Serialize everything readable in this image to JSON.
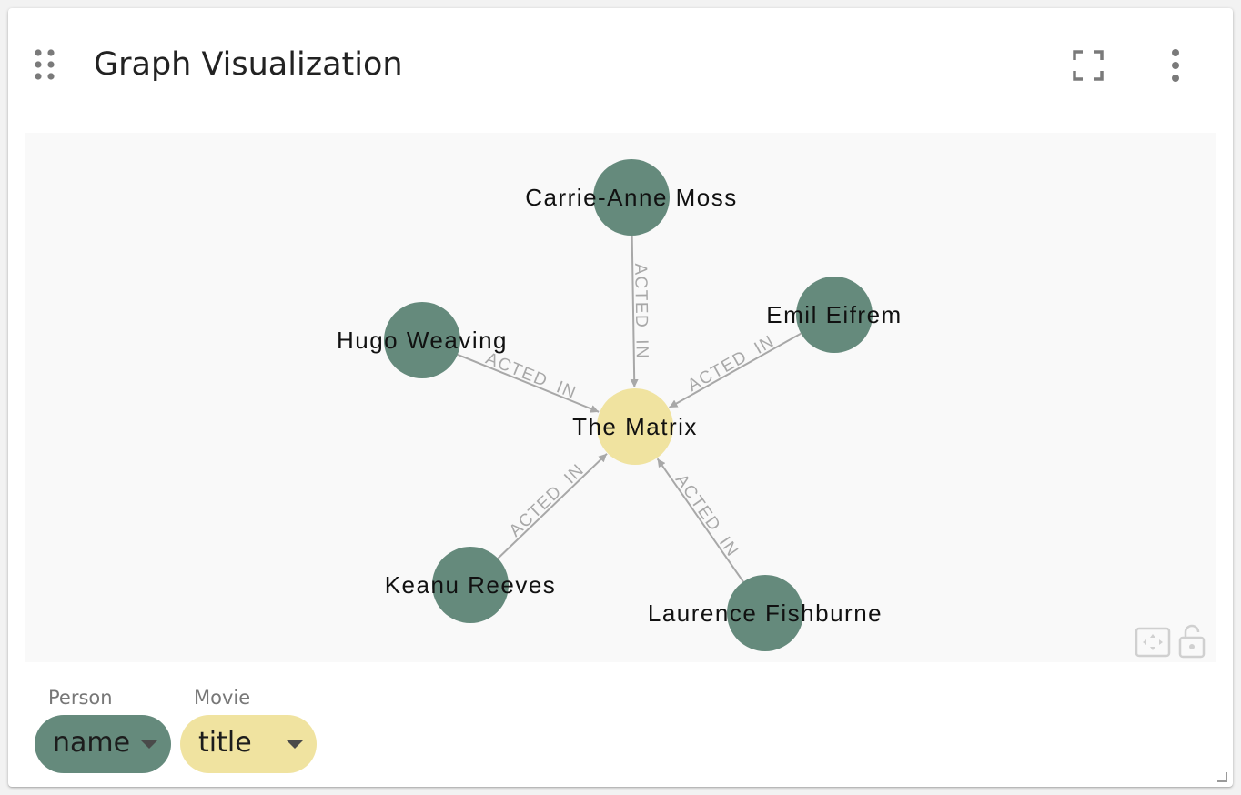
{
  "panel": {
    "title": "Graph Visualization"
  },
  "icons": {
    "drag": "drag-handle-icon",
    "fullscreen": "fullscreen-icon",
    "more": "more-vert-icon",
    "fit": "fit-to-screen-icon",
    "lock": "lock-open-icon"
  },
  "colors": {
    "person_node": "#658a7c",
    "movie_node": "#f0e3a0",
    "edge": "#a8a8a8",
    "graph_background": "#f9f9f9"
  },
  "graph": {
    "nodes": [
      {
        "id": "matrix",
        "label": "The Matrix",
        "type": "Movie"
      },
      {
        "id": "carrie",
        "label": "Carrie-Anne Moss",
        "type": "Person"
      },
      {
        "id": "hugo",
        "label": "Hugo Weaving",
        "type": "Person"
      },
      {
        "id": "emil",
        "label": "Emil Eifrem",
        "type": "Person"
      },
      {
        "id": "keanu",
        "label": "Keanu Reeves",
        "type": "Person"
      },
      {
        "id": "laurence",
        "label": "Laurence Fishburne",
        "type": "Person"
      }
    ],
    "edges": [
      {
        "from": "carrie",
        "to": "matrix",
        "label": "ACTED_IN"
      },
      {
        "from": "hugo",
        "to": "matrix",
        "label": "ACTED_IN"
      },
      {
        "from": "emil",
        "to": "matrix",
        "label": "ACTED_IN"
      },
      {
        "from": "keanu",
        "to": "matrix",
        "label": "ACTED_IN"
      },
      {
        "from": "laurence",
        "to": "matrix",
        "label": "ACTED_IN"
      }
    ]
  },
  "legend": [
    {
      "label": "Person",
      "property": "name"
    },
    {
      "label": "Movie",
      "property": "title"
    }
  ]
}
